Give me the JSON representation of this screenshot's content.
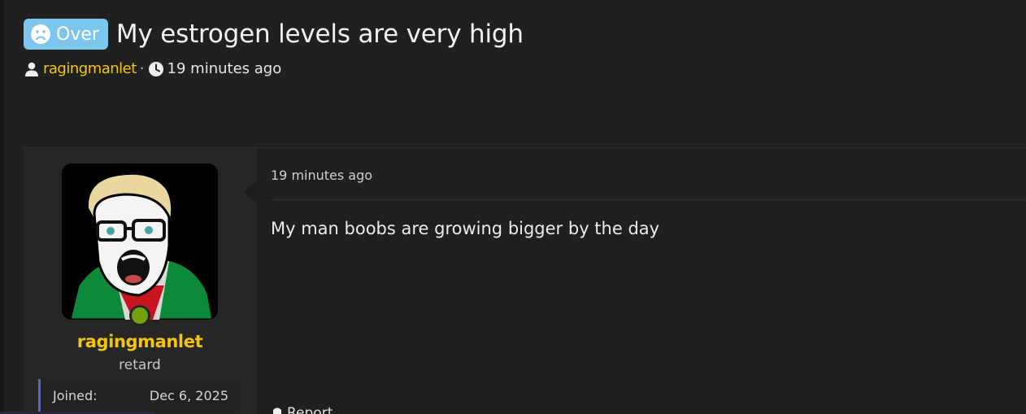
{
  "thread": {
    "prefix": "Over",
    "title": "My estrogen levels are very high",
    "author": "ragingmanlet",
    "separator": "·",
    "time": "19 minutes ago"
  },
  "post": {
    "date": "19 minutes ago",
    "body": "My man boobs are growing bigger by the day",
    "report_label": "Report",
    "user": {
      "name": "ragingmanlet",
      "title": "retard",
      "joined_label": "Joined:",
      "joined_value": "Dec 6, 2025",
      "online": true
    }
  },
  "colors": {
    "prefix_badge": "#7dc6ee",
    "username": "#f3c511",
    "online_dot": "#72a30f",
    "extras_accent": "#5865c9"
  },
  "icons": [
    "sad-face-icon",
    "user-icon",
    "clock-icon",
    "flag-icon"
  ]
}
